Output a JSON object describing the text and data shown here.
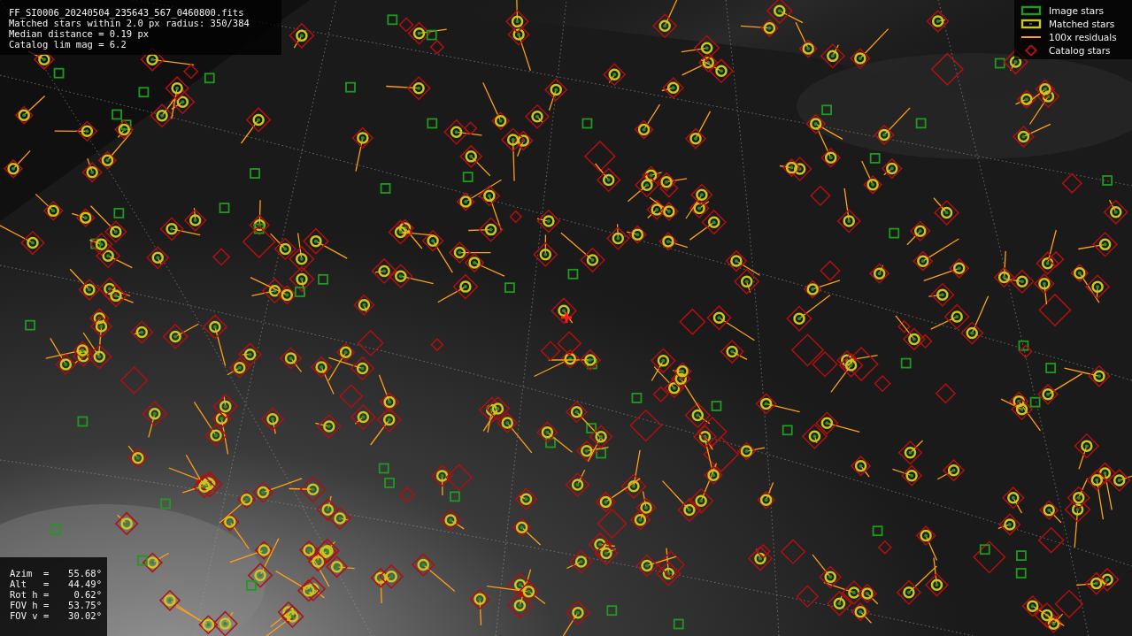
{
  "info_box": {
    "lines": [
      "FF_SI0006_20240504_235643_567_0460800.fits",
      "Matched stars within 2.0 px radius: 350/384",
      "Median distance = 0.19 px",
      "Catalog lim mag = 6.2"
    ]
  },
  "legend": {
    "items": [
      {
        "kind": "box",
        "color": "#1f9a1f",
        "label": "Image stars"
      },
      {
        "kind": "ring",
        "color": "#c8c81e",
        "label": "Matched stars"
      },
      {
        "kind": "line",
        "color": "#ff9f1a",
        "label": "100x residuals"
      },
      {
        "kind": "diamond",
        "color": "#b01010",
        "label": "Catalog stars"
      }
    ]
  },
  "pointing_panel": {
    "rows": [
      {
        "label": "Azim  =",
        "value": "55.68°"
      },
      {
        "label": "Alt   =",
        "value": "44.49°"
      },
      {
        "label": "Rot h =",
        "value": "0.62°"
      },
      {
        "label": "FOV h =",
        "value": "53.75°"
      },
      {
        "label": "FOV v =",
        "value": "30.02°"
      }
    ]
  }
}
